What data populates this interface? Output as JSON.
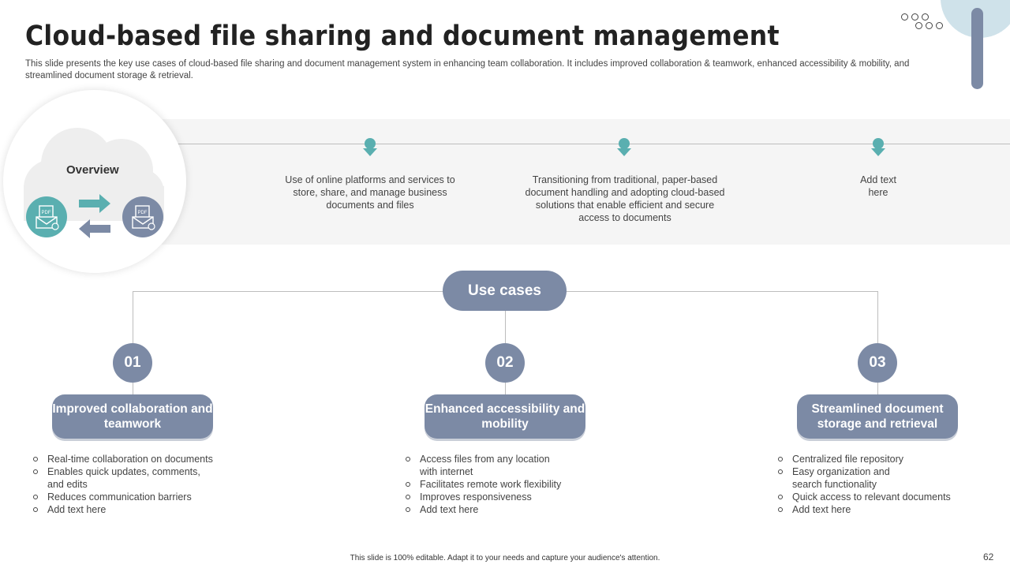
{
  "header": {
    "title": "Cloud-based file sharing and document management",
    "subtitle": "This slide presents the key use cases of cloud-based file sharing and document management system in enhancing team collaboration. It includes improved collaboration & teamwork, enhanced accessibility & mobility, and streamlined document storage & retrieval."
  },
  "overview": {
    "label": "Overview",
    "items": [
      {
        "text": "Use of online platforms and services to store, share, and manage business documents and files"
      },
      {
        "text": "Transitioning from traditional, paper-based document handling and adopting cloud-based solutions that enable efficient and secure access to documents"
      },
      {
        "text": "Add text here"
      }
    ],
    "icon_labels": {
      "left": "PDF",
      "right": "PDF"
    }
  },
  "use_cases": {
    "label": "Use cases",
    "cases": [
      {
        "number": "01",
        "title": "Improved collaboration and teamwork",
        "bullets": [
          "Real-time collaboration on documents",
          "Enables quick updates, comments, and edits",
          "Reduces communication barriers",
          "Add text here"
        ]
      },
      {
        "number": "02",
        "title": "Enhanced accessibility and mobility",
        "bullets": [
          "Access files from any location with internet",
          "Facilitates remote work flexibility",
          "Improves responsiveness",
          "Add text here"
        ]
      },
      {
        "number": "03",
        "title": "Streamlined document storage and retrieval",
        "bullets": [
          "Centralized file repository",
          "Easy organization and search functionality",
          "Quick access to relevant documents",
          "Add text here"
        ]
      }
    ]
  },
  "footer": {
    "note": "This slide is 100% editable. Adapt it to your needs and capture your audience's attention.",
    "page_number": "62"
  },
  "colors": {
    "accent_slate": "#7c8aa5",
    "accent_teal": "#5aafb0",
    "band_bg": "#f5f5f5",
    "deco_light_blue": "#cfe2ea"
  },
  "icons": [
    "pdf-file-icon",
    "arrow-right-icon",
    "arrow-left-icon",
    "pin-marker-icon",
    "cloud-icon"
  ]
}
